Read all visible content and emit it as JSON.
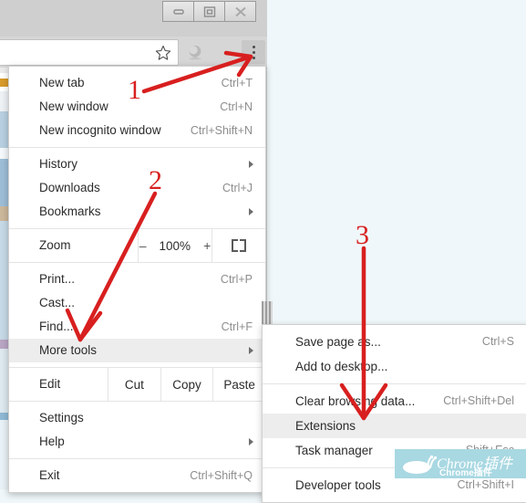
{
  "window": {
    "controls": [
      {
        "name": "minimize-button",
        "glyph": "minimize"
      },
      {
        "name": "maximize-button",
        "glyph": "maximize"
      },
      {
        "name": "close-button",
        "glyph": "close"
      }
    ]
  },
  "toolbar": {
    "star_icon": "bookmark-star-icon",
    "profile_icon": "profile-avatar-icon",
    "menu_button": "three-dot-menu-icon"
  },
  "chrome_menu": {
    "groups": [
      {
        "items": [
          {
            "label": "New tab",
            "shortcut": "Ctrl+T",
            "arrow": false,
            "highlight": false
          },
          {
            "label": "New window",
            "shortcut": "Ctrl+N",
            "arrow": false,
            "highlight": false
          },
          {
            "label": "New incognito window",
            "shortcut": "Ctrl+Shift+N",
            "arrow": false,
            "highlight": false
          }
        ]
      },
      {
        "items": [
          {
            "label": "History",
            "shortcut": "",
            "arrow": true,
            "highlight": false
          },
          {
            "label": "Downloads",
            "shortcut": "Ctrl+J",
            "arrow": false,
            "highlight": false
          },
          {
            "label": "Bookmarks",
            "shortcut": "",
            "arrow": true,
            "highlight": false
          }
        ]
      },
      {
        "items": [
          {
            "label": "Print...",
            "shortcut": "Ctrl+P",
            "arrow": false,
            "highlight": false
          },
          {
            "label": "Cast...",
            "shortcut": "",
            "arrow": false,
            "highlight": false
          },
          {
            "label": "Find...",
            "shortcut": "Ctrl+F",
            "arrow": false,
            "highlight": false
          },
          {
            "label": "More tools",
            "shortcut": "",
            "arrow": true,
            "highlight": true
          }
        ]
      },
      {
        "items": [
          {
            "label": "Settings",
            "shortcut": "",
            "arrow": false,
            "highlight": false
          },
          {
            "label": "Help",
            "shortcut": "",
            "arrow": true,
            "highlight": false
          }
        ]
      },
      {
        "items": [
          {
            "label": "Exit",
            "shortcut": "Ctrl+Shift+Q",
            "arrow": false,
            "highlight": false
          }
        ]
      }
    ],
    "zoom_row": {
      "label": "Zoom",
      "minus": "–",
      "level": "100%",
      "plus": "+",
      "fullscreen_icon": "fullscreen-icon"
    },
    "edit_row": {
      "label": "Edit",
      "cut": "Cut",
      "copy": "Copy",
      "paste": "Paste"
    }
  },
  "more_tools_submenu": {
    "groups": [
      {
        "items": [
          {
            "label": "Save page as...",
            "shortcut": "Ctrl+S",
            "highlight": false
          },
          {
            "label": "Add to desktop...",
            "shortcut": "",
            "highlight": false
          }
        ]
      },
      {
        "items": [
          {
            "label": "Clear browsing data...",
            "shortcut": "Ctrl+Shift+Del",
            "highlight": false
          },
          {
            "label": "Extensions",
            "shortcut": "",
            "highlight": true
          },
          {
            "label": "Task manager",
            "shortcut": "Shift+Esc",
            "highlight": false
          }
        ]
      },
      {
        "items": [
          {
            "label": "Developer tools",
            "shortcut": "Ctrl+Shift+I",
            "highlight": false
          }
        ]
      }
    ]
  },
  "annotations": {
    "color": "#d81f1f",
    "steps": [
      {
        "number": "1",
        "target": "three-dot-menu-icon"
      },
      {
        "number": "2",
        "target": "more-tools-menu-item"
      },
      {
        "number": "3",
        "target": "extensions-menu-item"
      }
    ]
  },
  "watermark": {
    "text": "Chrome插件",
    "subtext": "Chrome插件",
    "background": "#a8d8e2",
    "logo": "snail-icon"
  },
  "colors": {
    "page_background": "#f0f7fa",
    "menu_background": "#ffffff",
    "menu_highlight": "#ededed",
    "shortcut_text": "#8d8d8d",
    "frame": "#cfcfcf"
  }
}
